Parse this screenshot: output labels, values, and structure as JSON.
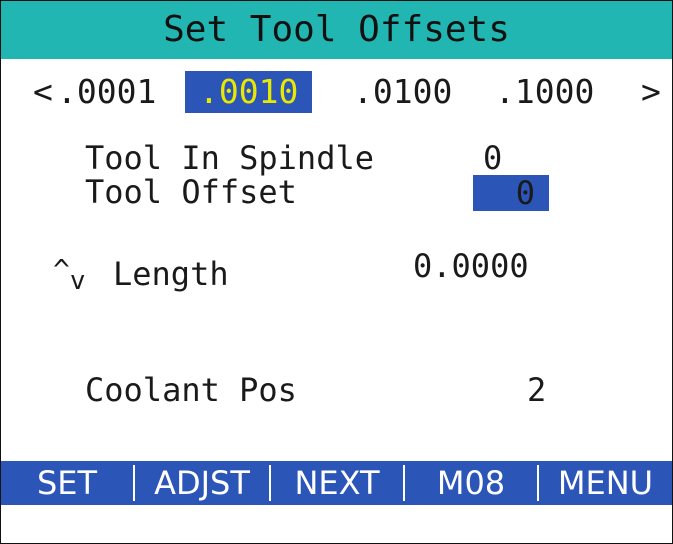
{
  "title": "Set Tool Offsets",
  "increment_bar": {
    "left_arrow": "<",
    "right_arrow": ">",
    "options": [
      ".0001",
      ".0010",
      ".0100",
      ".1000"
    ],
    "selected": ".0010"
  },
  "tool_in_spindle": {
    "label": "Tool In Spindle",
    "value": "0"
  },
  "tool_offset": {
    "label": "Tool Offset",
    "value": "0"
  },
  "length": {
    "up_symbol": "^",
    "down_symbol": "v",
    "label": "Length",
    "value": "0.0000"
  },
  "coolant_pos": {
    "label": "Coolant Pos",
    "value": "2"
  },
  "softkeys": [
    "SET",
    "ADJST",
    "NEXT",
    "M08",
    "MENU"
  ],
  "colors": {
    "title_bg": "#22b6b2",
    "highlight_bg": "#2c55b8",
    "highlight_text": "#e8e800",
    "softkey_text": "#ffffff"
  }
}
